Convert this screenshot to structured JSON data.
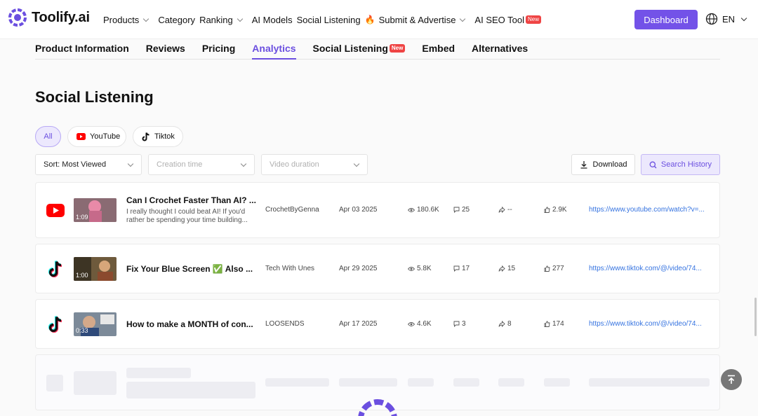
{
  "brand": {
    "name": "Toolify.ai",
    "accent": "#7352e8"
  },
  "nav": {
    "items": [
      {
        "label": "Products",
        "dropdown": true
      },
      {
        "label": "Category",
        "dropdown": false
      },
      {
        "label": "Ranking",
        "dropdown": true
      },
      {
        "label": "AI Models",
        "dropdown": false
      },
      {
        "label": "Social Listening",
        "dropdown": false
      },
      {
        "label": "Submit & Advertise",
        "dropdown": true
      },
      {
        "label": "AI SEO Tool",
        "dropdown": false
      }
    ],
    "new_badge": "New",
    "dashboard_label": "Dashboard",
    "language": "EN"
  },
  "tabs": [
    {
      "label": "Product Information",
      "active": false
    },
    {
      "label": "Reviews",
      "active": false
    },
    {
      "label": "Pricing",
      "active": false
    },
    {
      "label": "Analytics",
      "active": true
    },
    {
      "label": "Social Listening",
      "active": false,
      "badge": "New"
    },
    {
      "label": "Embed",
      "active": false
    },
    {
      "label": "Alternatives",
      "active": false
    }
  ],
  "section": {
    "title": "Social Listening"
  },
  "filters": {
    "platforms": [
      {
        "label": "All",
        "active": true,
        "icon": ""
      },
      {
        "label": "YouTube",
        "active": false,
        "icon": "youtube-icon"
      },
      {
        "label": "Tiktok",
        "active": false,
        "icon": "tiktok-icon"
      }
    ],
    "sort": "Sort: Most Viewed",
    "creation_time_placeholder": "Creation time",
    "video_duration_placeholder": "Video duration",
    "download_label": "Download",
    "search_history_label": "Search History"
  },
  "videos": [
    {
      "platform": "youtube",
      "duration": "1:09",
      "title": "Can I Crochet Faster Than AI? ...",
      "description": "I really thought I could beat AI! If you'd rather be spending your time building...",
      "author": "CrochetByGenna",
      "date": "Apr 03 2025",
      "views": "180.6K",
      "comments": "25",
      "shares": "--",
      "likes": "2.9K",
      "url": "https://www.youtube.com/watch?v=..."
    },
    {
      "platform": "tiktok",
      "duration": "1:00",
      "title": "Fix Your Blue Screen ✅ Also ...",
      "description": "",
      "author": "Tech With Unes",
      "date": "Apr 29 2025",
      "views": "5.8K",
      "comments": "17",
      "shares": "15",
      "likes": "277",
      "url": "https://www.tiktok.com/@/video/74..."
    },
    {
      "platform": "tiktok",
      "duration": "0:33",
      "title": "How to make a MONTH of con...",
      "description": "",
      "author": "LOOSENDS",
      "date": "Apr 17 2025",
      "views": "4.6K",
      "comments": "3",
      "shares": "8",
      "likes": "174",
      "url": "https://www.tiktok.com/@/video/74..."
    }
  ]
}
